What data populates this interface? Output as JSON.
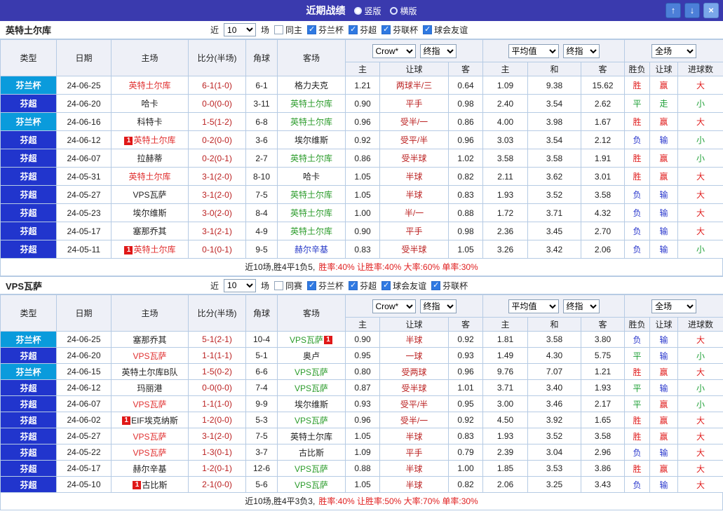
{
  "topbar": {
    "title": "近期战绩",
    "radios": [
      {
        "label": "竖版",
        "selected": true
      },
      {
        "label": "横版",
        "selected": false
      }
    ],
    "buttons": {
      "up": "↑",
      "down": "↓",
      "close": "×"
    }
  },
  "colors": {
    "topbar_bg": "#3a3aae",
    "btn_blue": "#4c7fd8",
    "btn_light": "#7aa7ea",
    "header_bg": "#eef0f7",
    "grid": "#b6cbe4",
    "league_super": "#2135cd",
    "league_cup": "#0a9bdc",
    "focus_home": "#e03030",
    "focus_away": "#2a9b2a",
    "link_team": "#2a3cc8",
    "score": "#bb2222",
    "handicap": "#bb2222",
    "win": "#e02020",
    "draw": "#1fa037",
    "loss": "#2836cc",
    "summary_red": "#e02020"
  },
  "sections": [
    {
      "team": "英特土尔库",
      "filter": {
        "near": "近",
        "count": "10",
        "unit": "场",
        "same": {
          "label": "同主",
          "checked": false
        },
        "leagues": [
          {
            "label": "芬兰杯",
            "checked": true
          },
          {
            "label": "芬超",
            "checked": true
          },
          {
            "label": "芬联杯",
            "checked": true
          },
          {
            "label": "球会友谊",
            "checked": true
          }
        ]
      },
      "header": {
        "base": [
          "类型",
          "日期",
          "主场",
          "比分(半场)",
          "角球",
          "客场"
        ],
        "odds_source": "Crow*",
        "odds_time": "终指",
        "avg_label": "平均值",
        "avg_time": "终指",
        "scope": "全场",
        "sub": [
          "主",
          "让球",
          "客",
          "主",
          "和",
          "客",
          "胜负",
          "让球",
          "进球数"
        ]
      },
      "rows": [
        {
          "type": "芬兰杯",
          "cup": true,
          "date": "24-06-25",
          "home": {
            "name": "英特土尔库",
            "color": "focus-home"
          },
          "score": "6-1(1-0)",
          "corner": "6-1",
          "away": {
            "name": "格力夫克"
          },
          "odds": [
            "1.21",
            "两球半/三",
            "0.64"
          ],
          "avg": [
            "1.09",
            "9.38",
            "15.62"
          ],
          "res": [
            [
              "胜",
              "w"
            ],
            [
              "赢",
              "w"
            ],
            [
              "大",
              "w"
            ]
          ]
        },
        {
          "type": "芬超",
          "cup": false,
          "date": "24-06-20",
          "home": {
            "name": "哈卡"
          },
          "score": "0-0(0-0)",
          "corner": "3-11",
          "away": {
            "name": "英特土尔库",
            "color": "focus-away"
          },
          "odds": [
            "0.90",
            "平手",
            "0.98"
          ],
          "avg": [
            "2.40",
            "3.54",
            "2.62"
          ],
          "res": [
            [
              "平",
              "d"
            ],
            [
              "走",
              "d"
            ],
            [
              "小",
              "d"
            ]
          ]
        },
        {
          "type": "芬兰杯",
          "cup": true,
          "date": "24-06-16",
          "home": {
            "name": "科特卡"
          },
          "score": "1-5(1-2)",
          "corner": "6-8",
          "away": {
            "name": "英特土尔库",
            "color": "focus-away"
          },
          "odds": [
            "0.96",
            "受半/一",
            "0.86"
          ],
          "avg": [
            "4.00",
            "3.98",
            "1.67"
          ],
          "res": [
            [
              "胜",
              "w"
            ],
            [
              "赢",
              "w"
            ],
            [
              "大",
              "w"
            ]
          ]
        },
        {
          "type": "芬超",
          "cup": false,
          "date": "24-06-12",
          "home": {
            "name": "英特土尔库",
            "color": "focus-home",
            "badge": "1"
          },
          "score": "0-2(0-0)",
          "corner": "3-6",
          "away": {
            "name": "埃尔维斯"
          },
          "odds": [
            "0.92",
            "受平/半",
            "0.96"
          ],
          "avg": [
            "3.03",
            "3.54",
            "2.12"
          ],
          "res": [
            [
              "负",
              "l"
            ],
            [
              "输",
              "l"
            ],
            [
              "小",
              "d"
            ]
          ]
        },
        {
          "type": "芬超",
          "cup": false,
          "date": "24-06-07",
          "home": {
            "name": "拉赫蒂"
          },
          "score": "0-2(0-1)",
          "corner": "2-7",
          "away": {
            "name": "英特土尔库",
            "color": "focus-away"
          },
          "odds": [
            "0.86",
            "受半球",
            "1.02"
          ],
          "avg": [
            "3.58",
            "3.58",
            "1.91"
          ],
          "res": [
            [
              "胜",
              "w"
            ],
            [
              "赢",
              "w"
            ],
            [
              "小",
              "d"
            ]
          ]
        },
        {
          "type": "芬超",
          "cup": false,
          "date": "24-05-31",
          "home": {
            "name": "英特土尔库",
            "color": "focus-home"
          },
          "score": "3-1(2-0)",
          "corner": "8-10",
          "away": {
            "name": "哈卡"
          },
          "odds": [
            "1.05",
            "半球",
            "0.82"
          ],
          "avg": [
            "2.11",
            "3.62",
            "3.01"
          ],
          "res": [
            [
              "胜",
              "w"
            ],
            [
              "赢",
              "w"
            ],
            [
              "大",
              "w"
            ]
          ]
        },
        {
          "type": "芬超",
          "cup": false,
          "date": "24-05-27",
          "home": {
            "name": "VPS瓦萨"
          },
          "score": "3-1(2-0)",
          "corner": "7-5",
          "away": {
            "name": "英特土尔库",
            "color": "focus-away"
          },
          "odds": [
            "1.05",
            "半球",
            "0.83"
          ],
          "avg": [
            "1.93",
            "3.52",
            "3.58"
          ],
          "res": [
            [
              "负",
              "l"
            ],
            [
              "输",
              "l"
            ],
            [
              "大",
              "w"
            ]
          ]
        },
        {
          "type": "芬超",
          "cup": false,
          "date": "24-05-23",
          "home": {
            "name": "埃尔维斯"
          },
          "score": "3-0(2-0)",
          "corner": "8-4",
          "away": {
            "name": "英特土尔库",
            "color": "focus-away"
          },
          "odds": [
            "1.00",
            "半/一",
            "0.88"
          ],
          "avg": [
            "1.72",
            "3.71",
            "4.32"
          ],
          "res": [
            [
              "负",
              "l"
            ],
            [
              "输",
              "l"
            ],
            [
              "大",
              "w"
            ]
          ]
        },
        {
          "type": "芬超",
          "cup": false,
          "date": "24-05-17",
          "home": {
            "name": "塞那乔其"
          },
          "score": "3-1(2-1)",
          "corner": "4-9",
          "away": {
            "name": "英特土尔库",
            "color": "focus-away"
          },
          "odds": [
            "0.90",
            "平手",
            "0.98"
          ],
          "avg": [
            "2.36",
            "3.45",
            "2.70"
          ],
          "res": [
            [
              "负",
              "l"
            ],
            [
              "输",
              "l"
            ],
            [
              "大",
              "w"
            ]
          ]
        },
        {
          "type": "芬超",
          "cup": false,
          "date": "24-05-11",
          "home": {
            "name": "英特土尔库",
            "color": "focus-home",
            "badge": "1"
          },
          "score": "0-1(0-1)",
          "corner": "9-5",
          "away": {
            "name": "赫尔辛基",
            "color": "link"
          },
          "odds": [
            "0.83",
            "受半球",
            "1.05"
          ],
          "avg": [
            "3.26",
            "3.42",
            "2.06"
          ],
          "res": [
            [
              "负",
              "l"
            ],
            [
              "输",
              "l"
            ],
            [
              "小",
              "d"
            ]
          ]
        }
      ],
      "summary": {
        "record": "近10场,胜4平1负5,",
        "rates": "胜率:40% 让胜率:40% 大率:60% 单率:30%"
      }
    },
    {
      "team": "VPS瓦萨",
      "filter": {
        "near": "近",
        "count": "10",
        "unit": "场",
        "same": {
          "label": "同赛",
          "checked": false
        },
        "leagues": [
          {
            "label": "芬兰杯",
            "checked": true
          },
          {
            "label": "芬超",
            "checked": true
          },
          {
            "label": "球会友谊",
            "checked": true
          },
          {
            "label": "芬联杯",
            "checked": true
          }
        ]
      },
      "header": {
        "base": [
          "类型",
          "日期",
          "主场",
          "比分(半场)",
          "角球",
          "客场"
        ],
        "odds_source": "Crow*",
        "odds_time": "终指",
        "avg_label": "平均值",
        "avg_time": "终指",
        "scope": "全场",
        "sub": [
          "主",
          "让球",
          "客",
          "主",
          "和",
          "客",
          "胜负",
          "让球",
          "进球数"
        ]
      },
      "rows": [
        {
          "type": "芬兰杯",
          "cup": true,
          "date": "24-06-25",
          "home": {
            "name": "塞那乔其"
          },
          "score": "5-1(2-1)",
          "corner": "10-4",
          "away": {
            "name": "VPS瓦萨",
            "color": "focus-away",
            "badge": "1",
            "badge_pos": "after"
          },
          "odds": [
            "0.90",
            "半球",
            "0.92"
          ],
          "avg": [
            "1.81",
            "3.58",
            "3.80"
          ],
          "res": [
            [
              "负",
              "l"
            ],
            [
              "输",
              "l"
            ],
            [
              "大",
              "w"
            ]
          ]
        },
        {
          "type": "芬超",
          "cup": false,
          "date": "24-06-20",
          "home": {
            "name": "VPS瓦萨",
            "color": "focus-home"
          },
          "score": "1-1(1-1)",
          "corner": "5-1",
          "away": {
            "name": "奥卢"
          },
          "odds": [
            "0.95",
            "一球",
            "0.93"
          ],
          "avg": [
            "1.49",
            "4.30",
            "5.75"
          ],
          "res": [
            [
              "平",
              "d"
            ],
            [
              "输",
              "l"
            ],
            [
              "小",
              "d"
            ]
          ]
        },
        {
          "type": "芬兰杯",
          "cup": true,
          "date": "24-06-15",
          "home": {
            "name": "英特土尔库B队"
          },
          "score": "1-5(0-2)",
          "corner": "6-6",
          "away": {
            "name": "VPS瓦萨",
            "color": "focus-away"
          },
          "odds": [
            "0.80",
            "受两球",
            "0.96"
          ],
          "avg": [
            "9.76",
            "7.07",
            "1.21"
          ],
          "res": [
            [
              "胜",
              "w"
            ],
            [
              "赢",
              "w"
            ],
            [
              "大",
              "w"
            ]
          ]
        },
        {
          "type": "芬超",
          "cup": false,
          "date": "24-06-12",
          "home": {
            "name": "玛丽港"
          },
          "score": "0-0(0-0)",
          "corner": "7-4",
          "away": {
            "name": "VPS瓦萨",
            "color": "focus-away"
          },
          "odds": [
            "0.87",
            "受半球",
            "1.01"
          ],
          "avg": [
            "3.71",
            "3.40",
            "1.93"
          ],
          "res": [
            [
              "平",
              "d"
            ],
            [
              "输",
              "l"
            ],
            [
              "小",
              "d"
            ]
          ]
        },
        {
          "type": "芬超",
          "cup": false,
          "date": "24-06-07",
          "home": {
            "name": "VPS瓦萨",
            "color": "focus-home"
          },
          "score": "1-1(1-0)",
          "corner": "9-9",
          "away": {
            "name": "埃尔维斯"
          },
          "odds": [
            "0.93",
            "受平/半",
            "0.95"
          ],
          "avg": [
            "3.00",
            "3.46",
            "2.17"
          ],
          "res": [
            [
              "平",
              "d"
            ],
            [
              "赢",
              "w"
            ],
            [
              "小",
              "d"
            ]
          ]
        },
        {
          "type": "芬超",
          "cup": false,
          "date": "24-06-02",
          "home": {
            "name": "EIF埃克纳斯",
            "badge": "1"
          },
          "score": "1-2(0-0)",
          "corner": "5-3",
          "away": {
            "name": "VPS瓦萨",
            "color": "focus-away"
          },
          "odds": [
            "0.96",
            "受半/一",
            "0.92"
          ],
          "avg": [
            "4.50",
            "3.92",
            "1.65"
          ],
          "res": [
            [
              "胜",
              "w"
            ],
            [
              "赢",
              "w"
            ],
            [
              "大",
              "w"
            ]
          ]
        },
        {
          "type": "芬超",
          "cup": false,
          "date": "24-05-27",
          "home": {
            "name": "VPS瓦萨",
            "color": "focus-home"
          },
          "score": "3-1(2-0)",
          "corner": "7-5",
          "away": {
            "name": "英特土尔库"
          },
          "odds": [
            "1.05",
            "半球",
            "0.83"
          ],
          "avg": [
            "1.93",
            "3.52",
            "3.58"
          ],
          "res": [
            [
              "胜",
              "w"
            ],
            [
              "赢",
              "w"
            ],
            [
              "大",
              "w"
            ]
          ]
        },
        {
          "type": "芬超",
          "cup": false,
          "date": "24-05-22",
          "home": {
            "name": "VPS瓦萨",
            "color": "focus-home"
          },
          "score": "1-3(0-1)",
          "corner": "3-7",
          "away": {
            "name": "古比斯"
          },
          "odds": [
            "1.09",
            "平手",
            "0.79"
          ],
          "avg": [
            "2.39",
            "3.04",
            "2.96"
          ],
          "res": [
            [
              "负",
              "l"
            ],
            [
              "输",
              "l"
            ],
            [
              "大",
              "w"
            ]
          ]
        },
        {
          "type": "芬超",
          "cup": false,
          "date": "24-05-17",
          "home": {
            "name": "赫尔辛基"
          },
          "score": "1-2(0-1)",
          "corner": "12-6",
          "away": {
            "name": "VPS瓦萨",
            "color": "focus-away"
          },
          "odds": [
            "0.88",
            "半球",
            "1.00"
          ],
          "avg": [
            "1.85",
            "3.53",
            "3.86"
          ],
          "res": [
            [
              "胜",
              "w"
            ],
            [
              "赢",
              "w"
            ],
            [
              "大",
              "w"
            ]
          ]
        },
        {
          "type": "芬超",
          "cup": false,
          "date": "24-05-10",
          "home": {
            "name": "古比斯",
            "badge": "1"
          },
          "score": "2-1(0-0)",
          "corner": "5-6",
          "away": {
            "name": "VPS瓦萨",
            "color": "focus-away"
          },
          "odds": [
            "1.05",
            "半球",
            "0.82"
          ],
          "avg": [
            "2.06",
            "3.25",
            "3.43"
          ],
          "res": [
            [
              "负",
              "l"
            ],
            [
              "输",
              "l"
            ],
            [
              "大",
              "w"
            ]
          ]
        }
      ],
      "summary": {
        "record": "近10场,胜4平3负3,",
        "rates": "胜率:40% 让胜率:50% 大率:70% 单率:30%"
      }
    }
  ]
}
